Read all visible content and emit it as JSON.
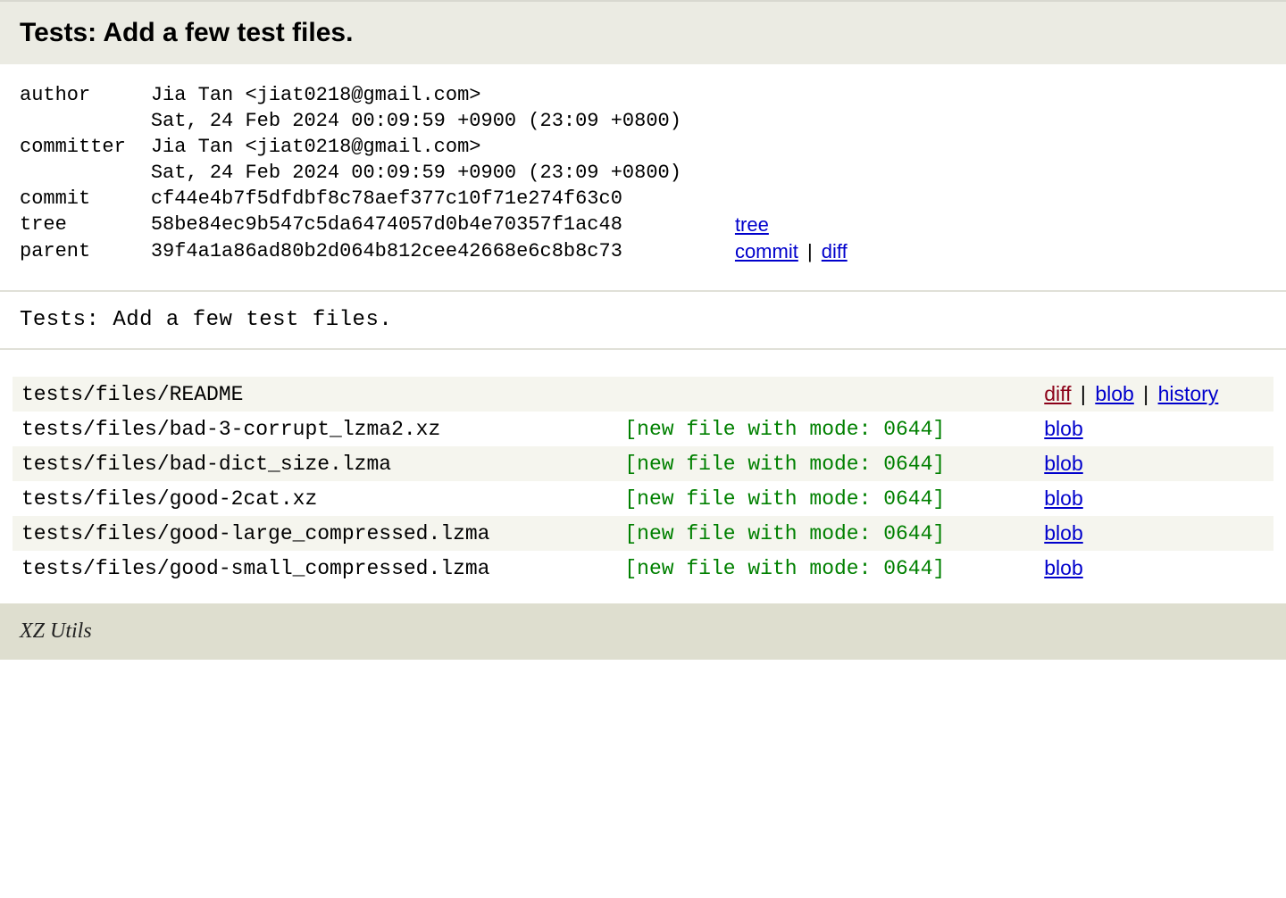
{
  "header": {
    "title": "Tests: Add a few test files."
  },
  "meta": {
    "author_label": "author",
    "author_value": "Jia Tan <jiat0218@gmail.com>",
    "author_date": "Sat, 24 Feb 2024 00:09:59 +0900 (23:09 +0800)",
    "committer_label": "committer",
    "committer_value": "Jia Tan <jiat0218@gmail.com>",
    "committer_date": "Sat, 24 Feb 2024 00:09:59 +0900 (23:09 +0800)",
    "commit_label": "commit",
    "commit_hash": "cf44e4b7f5dfdbf8c78aef377c10f71e274f63c0",
    "tree_label": "tree",
    "tree_hash": "58be84ec9b547c5da6474057d0b4e70357f1ac48",
    "tree_link": "tree",
    "parent_label": "parent",
    "parent_hash": "39f4a1a86ad80b2d064b812cee42668e6c8b8c73",
    "parent_commit_link": "commit",
    "parent_diff_link": "diff",
    "separator": " | "
  },
  "message": "Tests:  Add  a  few  test  files.",
  "files": [
    {
      "path": "tests/files/README",
      "mode": "",
      "actions": [
        {
          "label": "diff",
          "style": "dark"
        },
        {
          "label": "blob",
          "style": "blue"
        },
        {
          "label": "history",
          "style": "blue"
        }
      ]
    },
    {
      "path": "tests/files/bad-3-corrupt_lzma2.xz",
      "mode": "[new file with mode: 0644]",
      "actions": [
        {
          "label": "blob",
          "style": "blue"
        }
      ]
    },
    {
      "path": "tests/files/bad-dict_size.lzma",
      "mode": "[new file with mode: 0644]",
      "actions": [
        {
          "label": "blob",
          "style": "blue"
        }
      ]
    },
    {
      "path": "tests/files/good-2cat.xz",
      "mode": "[new file with mode: 0644]",
      "actions": [
        {
          "label": "blob",
          "style": "blue"
        }
      ]
    },
    {
      "path": "tests/files/good-large_compressed.lzma",
      "mode": "[new file with mode: 0644]",
      "actions": [
        {
          "label": "blob",
          "style": "blue"
        }
      ]
    },
    {
      "path": "tests/files/good-small_compressed.lzma",
      "mode": "[new file with mode: 0644]",
      "actions": [
        {
          "label": "blob",
          "style": "blue"
        }
      ]
    }
  ],
  "footer": {
    "text": "XZ Utils"
  }
}
